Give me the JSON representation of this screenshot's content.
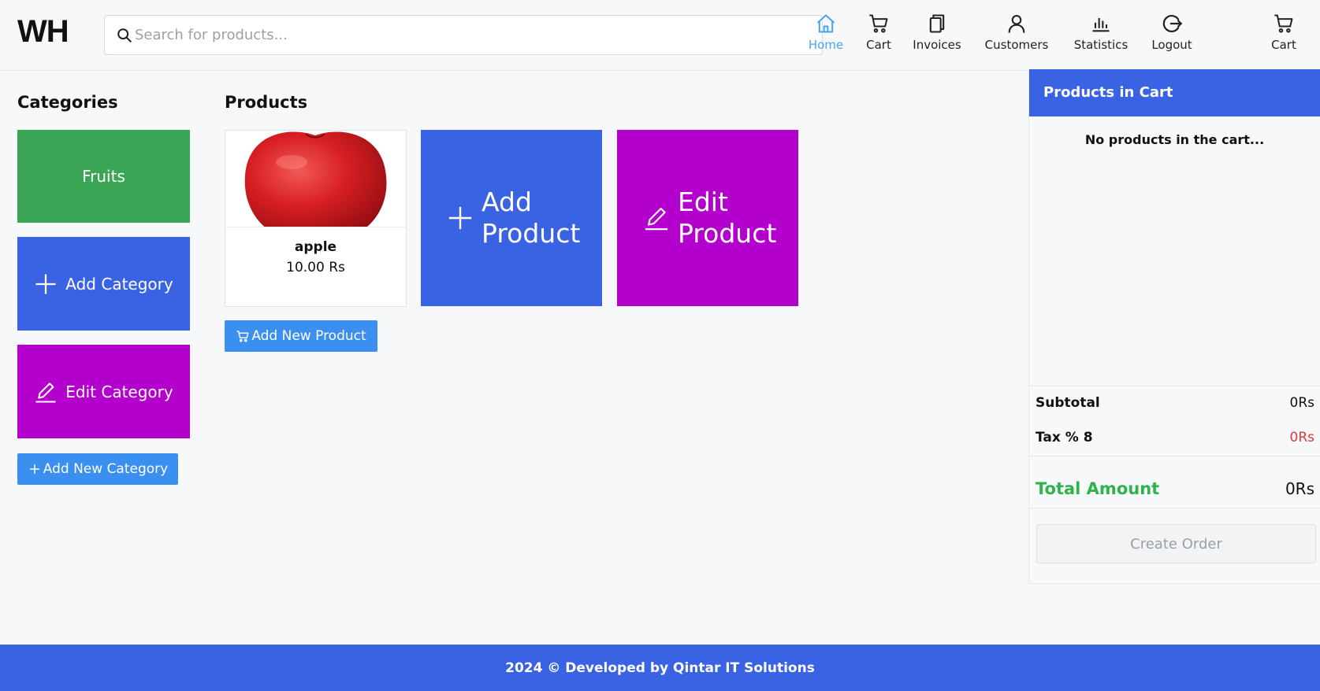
{
  "app": {
    "logo": "WH"
  },
  "search": {
    "placeholder": "Search for products..."
  },
  "nav": {
    "items": [
      {
        "label": "Home",
        "icon": "home-icon",
        "active": true
      },
      {
        "label": "Cart",
        "icon": "cart-icon"
      },
      {
        "label": "Invoices",
        "icon": "invoice-icon"
      },
      {
        "label": "Customers",
        "icon": "user-icon"
      },
      {
        "label": "Statistics",
        "icon": "chart-icon"
      },
      {
        "label": "Logout",
        "icon": "logout-icon"
      },
      {
        "label": "Cart",
        "icon": "cart-icon"
      }
    ]
  },
  "categories": {
    "title": "Categories",
    "items": [
      {
        "label": "Fruits",
        "color": "#3aa655"
      }
    ],
    "add_label": "Add Category",
    "edit_label": "Edit Category",
    "add_new_label": "Add New Category"
  },
  "products": {
    "title": "Products",
    "items": [
      {
        "name": "apple",
        "price": "10.00 Rs"
      }
    ],
    "add_label": "Add Product",
    "edit_label": "Edit Product",
    "add_new_label": "Add New Product"
  },
  "cart": {
    "title": "Products in Cart",
    "empty_text": "No products in the cart...",
    "subtotal_label": "Subtotal",
    "subtotal_value": "0Rs",
    "tax_label": "Tax % 8",
    "tax_value": "0Rs",
    "total_label": "Total Amount",
    "total_value": "0Rs",
    "create_order_label": "Create Order"
  },
  "footer": {
    "text": "2024 © Developed by Qintar IT Solutions"
  },
  "colors": {
    "primary": "#3a63e4",
    "green": "#3aa655",
    "magenta": "#b300cc",
    "button_blue": "#3b8ff0",
    "total_green": "#2fb24c",
    "tax_red": "#d63a3a",
    "active_nav": "#4aa3f0"
  }
}
